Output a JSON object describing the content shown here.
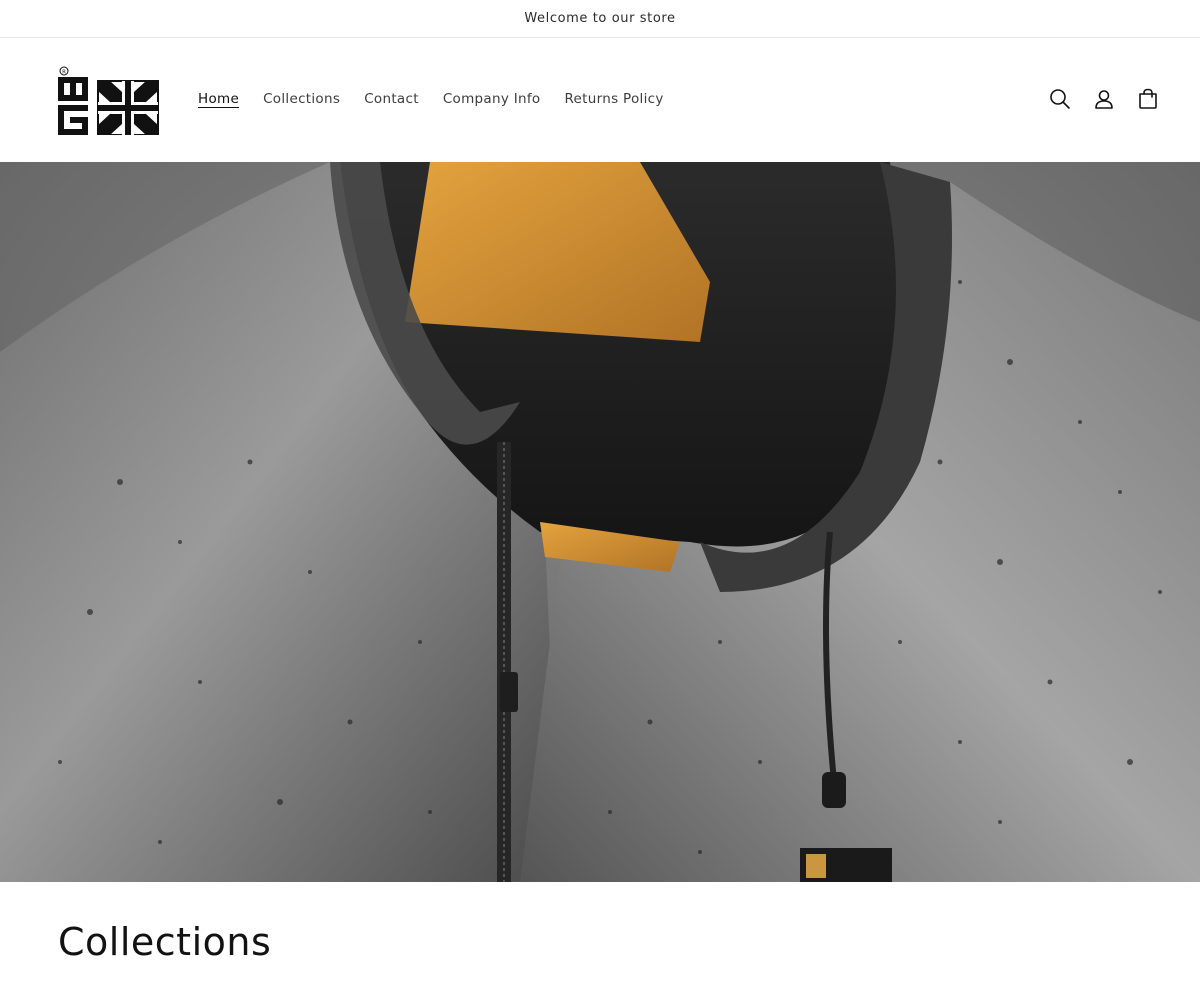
{
  "announcement": {
    "text": "Welcome to our store"
  },
  "header": {
    "logo_alt": "GB logo",
    "nav": [
      {
        "label": "Home",
        "active": true
      },
      {
        "label": "Collections",
        "active": false
      },
      {
        "label": "Contact",
        "active": false
      },
      {
        "label": "Company Info",
        "active": false
      },
      {
        "label": "Returns Policy",
        "active": false
      }
    ],
    "icons": [
      "search-icon",
      "account-icon",
      "cart-icon"
    ]
  },
  "hero": {
    "image_subject": "black hooded jacket on wooden hanger with water droplets"
  },
  "section": {
    "title": "Collections"
  },
  "colors": {
    "text": "#121212",
    "border": "#e6e6e6",
    "background": "#ffffff"
  }
}
